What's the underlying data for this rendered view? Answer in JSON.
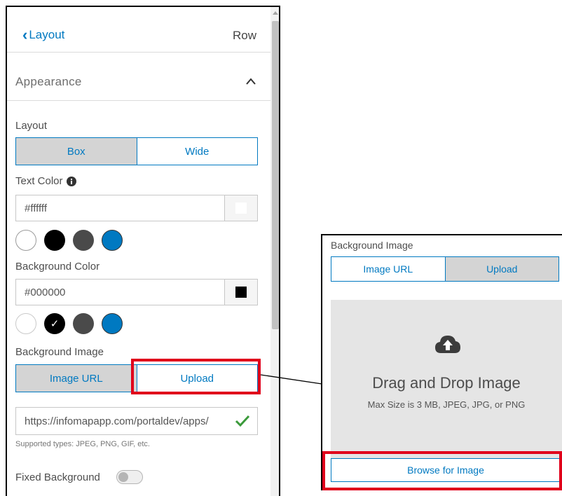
{
  "header": {
    "back_label": "Layout",
    "section_label": "Row"
  },
  "appearance": {
    "title": "Appearance"
  },
  "layout": {
    "label": "Layout",
    "options": [
      "Box",
      "Wide"
    ],
    "selected": "Box"
  },
  "text_color": {
    "label": "Text Color",
    "value": "#ffffff",
    "swatch_color": "#ffffff",
    "presets": [
      "#ffffff",
      "#000000",
      "#4a4a4a",
      "#0079c1"
    ],
    "selected_preset": "#ffffff"
  },
  "background_color": {
    "label": "Background Color",
    "value": "#000000",
    "swatch_color": "#000000",
    "presets": [
      "#ffffff",
      "#000000",
      "#4a4a4a",
      "#0079c1"
    ],
    "selected_preset": "#000000"
  },
  "background_image": {
    "label": "Background Image",
    "tabs": [
      "Image URL",
      "Upload"
    ],
    "selected_tab": "Image URL",
    "url_value": "https://infomapapp.com/portaldev/apps/",
    "hint": "Supported types: JPEG, PNG, GIF, etc."
  },
  "fixed_background": {
    "label": "Fixed Background",
    "enabled": false
  },
  "upload_panel": {
    "label": "Background Image",
    "tabs": [
      "Image URL",
      "Upload"
    ],
    "selected_tab": "Upload",
    "drop_title": "Drag and Drop Image",
    "drop_subtitle": "Max Size is 3 MB, JPEG, JPG, or PNG",
    "browse_label": "Browse for Image"
  },
  "colors": {
    "accent": "#0079c1",
    "highlight": "#e0001b",
    "check": "#3a9a3a"
  }
}
